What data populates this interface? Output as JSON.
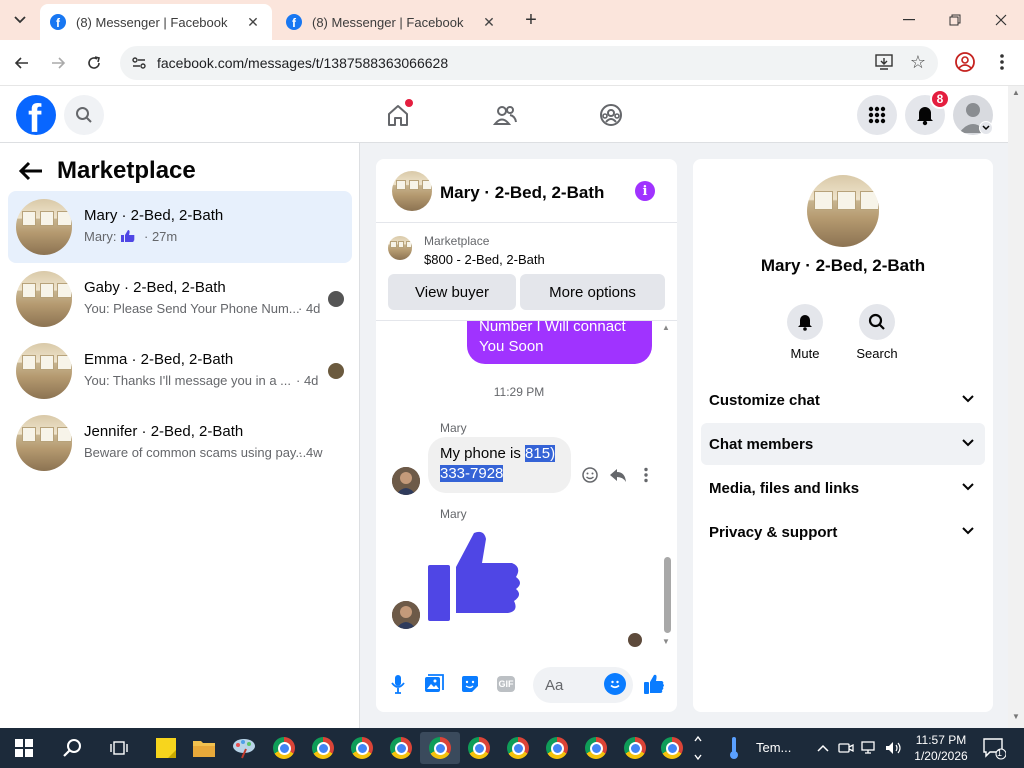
{
  "browser": {
    "tabs": [
      {
        "title": "(8) Messenger | Facebook",
        "active": true
      },
      {
        "title": "(8) Messenger | Facebook",
        "active": false
      }
    ],
    "url": "facebook.com/messages/t/1387588363066628"
  },
  "fb_header": {
    "notification_count": "8",
    "icons": [
      "home-icon",
      "friends-icon",
      "groups-icon",
      "menu-grid-icon",
      "bell-icon"
    ]
  },
  "sidebar": {
    "title": "Marketplace",
    "conversations": [
      {
        "name": "Mary · 2-Bed, 2-Bath",
        "preview": "Mary:",
        "time": "· 27m",
        "active": true
      },
      {
        "name": "Gaby · 2-Bed, 2-Bath",
        "preview": "You: Please Send Your Phone Num...",
        "time": "· 4d"
      },
      {
        "name": "Emma · 2-Bed, 2-Bath",
        "preview": "You: Thanks I'll message you in a ...",
        "time": "· 4d"
      },
      {
        "name": "Jennifer · 2-Bed, 2-Bath",
        "preview": "Beware of common scams using pay...",
        "time": "· 4w"
      }
    ]
  },
  "chat": {
    "title": "Mary · 2-Bed, 2-Bath",
    "marketplace_label": "Marketplace",
    "listing": "$800 - 2-Bed, 2-Bath",
    "view_buyer": "View buyer",
    "more_options": "More options",
    "outgoing_partial_line1": "Number I Will connact",
    "outgoing_partial_line2": "You Soon",
    "timestamp": "11:29 PM",
    "sender1": "Mary",
    "msg_plain": "My phone is ",
    "msg_selected_1": "815) ",
    "msg_selected_2": "333-7928",
    "sender2": "Mary",
    "composer_placeholder": "Aa"
  },
  "info_panel": {
    "title": "Mary · 2-Bed, 2-Bath",
    "actions": [
      {
        "label": "Mute"
      },
      {
        "label": "Search"
      }
    ],
    "sections": [
      {
        "label": "Customize chat"
      },
      {
        "label": "Chat members",
        "highlighted": true
      },
      {
        "label": "Media, files and links"
      },
      {
        "label": "Privacy & support"
      }
    ]
  },
  "taskbar": {
    "weather": "Tem...",
    "time": "11:57 PM",
    "date": "1/20/2026",
    "notification_count": "1"
  },
  "colors": {
    "fb_blue": "#0866ff",
    "messenger_purple": "#a033ff",
    "like_blue": "#4f46e5",
    "selection": "#3563d6"
  }
}
